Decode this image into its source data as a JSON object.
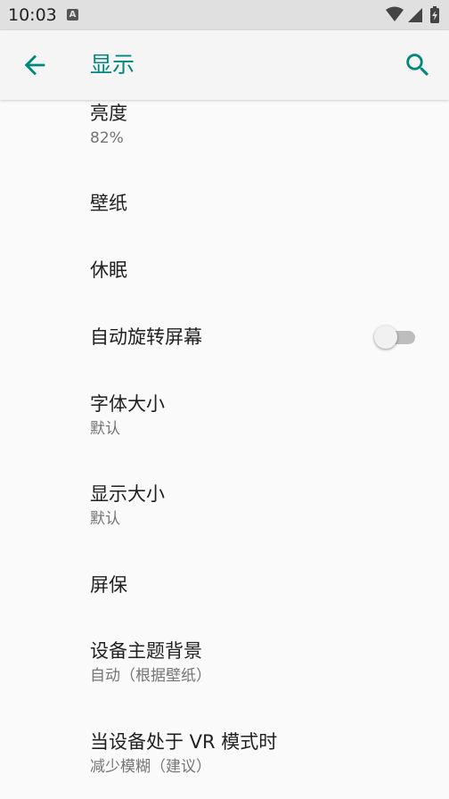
{
  "status_bar": {
    "time": "10:03",
    "notification_icon": "A"
  },
  "app_bar": {
    "title": "显示",
    "back_icon": "arrow-back-icon",
    "search_icon": "search-icon"
  },
  "colors": {
    "accent": "#00897b",
    "title_text": "#212121",
    "summary_text": "#757575",
    "background": "#fafafa"
  },
  "preferences": [
    {
      "title": "亮度",
      "summary": "82%"
    },
    {
      "title": "壁纸"
    },
    {
      "title": "休眠"
    },
    {
      "title": "自动旋转屏幕",
      "toggle": false
    },
    {
      "title": "字体大小",
      "summary": "默认"
    },
    {
      "title": "显示大小",
      "summary": "默认"
    },
    {
      "title": "屏保"
    },
    {
      "title": "设备主题背景",
      "summary": "自动（根据壁纸）"
    },
    {
      "title": "当设备处于 VR 模式时",
      "summary": "减少模糊（建议）"
    }
  ]
}
